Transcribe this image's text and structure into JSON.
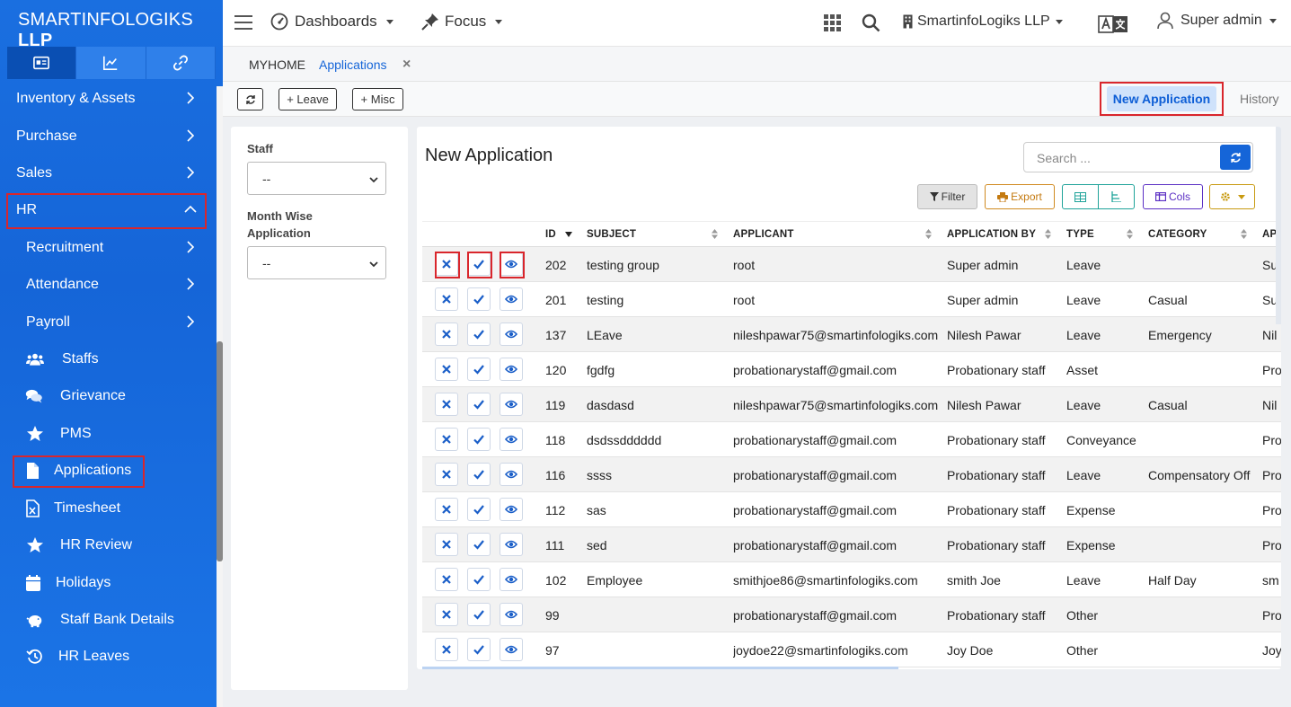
{
  "brand": {
    "name_light": "SMARTINFOLOGIKS",
    "name_bold": "LLP"
  },
  "sidebar_tabs": [
    "id-card-icon",
    "chart-line-icon",
    "link-icon"
  ],
  "sidebar": {
    "top_items": [
      {
        "label": "Inventory & Assets"
      },
      {
        "label": "Purchase"
      },
      {
        "label": "Sales"
      },
      {
        "label": "HR"
      }
    ],
    "hr_sub": [
      {
        "label": "Recruitment"
      },
      {
        "label": "Attendance"
      },
      {
        "label": "Payroll"
      }
    ],
    "hr_links": [
      {
        "label": "Staffs",
        "icon": "users-icon"
      },
      {
        "label": "Grievance",
        "icon": "comments-icon"
      },
      {
        "label": "PMS",
        "icon": "star-icon"
      },
      {
        "label": "Applications",
        "icon": "file-icon"
      },
      {
        "label": "Timesheet",
        "icon": "excel-file-icon"
      },
      {
        "label": "HR Review",
        "icon": "star-icon"
      },
      {
        "label": "Holidays",
        "icon": "calendar-icon"
      },
      {
        "label": "Staff Bank Details",
        "icon": "piggy-bank-icon"
      },
      {
        "label": "HR Leaves",
        "icon": "history-icon"
      }
    ]
  },
  "topbar": {
    "dashboards": "Dashboards",
    "focus": "Focus",
    "company": "SmartinfoLogiks LLP",
    "user": "Super admin"
  },
  "breadcrumb": {
    "home": "MYHOME",
    "current": "Applications",
    "close": "×"
  },
  "actions": {
    "leave": "+ Leave",
    "misc": "+ Misc",
    "new_application": "New Application",
    "history": "History"
  },
  "filters": {
    "staff_label": "Staff",
    "staff_value": "--",
    "month_label_1": "Month Wise",
    "month_label_2": "Application",
    "month_value": "--"
  },
  "main": {
    "title": "New Application",
    "search_placeholder": "Search ...",
    "filter": "Filter",
    "export": "Export",
    "cols": "Cols"
  },
  "columns": [
    "ID",
    "SUBJECT",
    "APPLICANT",
    "APPLICATION BY",
    "TYPE",
    "CATEGORY",
    "AP"
  ],
  "rows": [
    {
      "id": "202",
      "subject": "testing group",
      "applicant": "root",
      "by": "Super admin",
      "type": "Leave",
      "category": "",
      "ap": "Su"
    },
    {
      "id": "201",
      "subject": "testing",
      "applicant": "root",
      "by": "Super admin",
      "type": "Leave",
      "category": "Casual",
      "ap": "Su"
    },
    {
      "id": "137",
      "subject": "LEave",
      "applicant": "nileshpawar75@smartinfologiks.com",
      "by": "Nilesh Pawar",
      "type": "Leave",
      "category": "Emergency",
      "ap": "Nil"
    },
    {
      "id": "120",
      "subject": "fgdfg",
      "applicant": "probationarystaff@gmail.com",
      "by": "Probationary staff",
      "type": "Asset",
      "category": "",
      "ap": "Pro"
    },
    {
      "id": "119",
      "subject": "dasdasd",
      "applicant": "nileshpawar75@smartinfologiks.com",
      "by": "Nilesh Pawar",
      "type": "Leave",
      "category": "Casual",
      "ap": "Nil"
    },
    {
      "id": "118",
      "subject": "dsdssdddddd",
      "applicant": "probationarystaff@gmail.com",
      "by": "Probationary staff",
      "type": "Conveyance",
      "category": "",
      "ap": "Pro"
    },
    {
      "id": "116",
      "subject": "ssss",
      "applicant": "probationarystaff@gmail.com",
      "by": "Probationary staff",
      "type": "Leave",
      "category": "Compensatory Off",
      "ap": "Pro"
    },
    {
      "id": "112",
      "subject": "sas",
      "applicant": "probationarystaff@gmail.com",
      "by": "Probationary staff",
      "type": "Expense",
      "category": "",
      "ap": "Pro"
    },
    {
      "id": "111",
      "subject": "sed",
      "applicant": "probationarystaff@gmail.com",
      "by": "Probationary staff",
      "type": "Expense",
      "category": "",
      "ap": "Pro"
    },
    {
      "id": "102",
      "subject": "Employee",
      "applicant": "smithjoe86@smartinfologiks.com",
      "by": "smith Joe",
      "type": "Leave",
      "category": "Half Day",
      "ap": "sm"
    },
    {
      "id": "99",
      "subject": "",
      "applicant": "probationarystaff@gmail.com",
      "by": "Probationary staff",
      "type": "Other",
      "category": "",
      "ap": "Pro"
    },
    {
      "id": "97",
      "subject": "",
      "applicant": "joydoe22@smartinfologiks.com",
      "by": "Joy Doe",
      "type": "Other",
      "category": "",
      "ap": "Joy"
    }
  ],
  "colors": {
    "accent": "#1565d8",
    "highlight": "#d9262c"
  }
}
